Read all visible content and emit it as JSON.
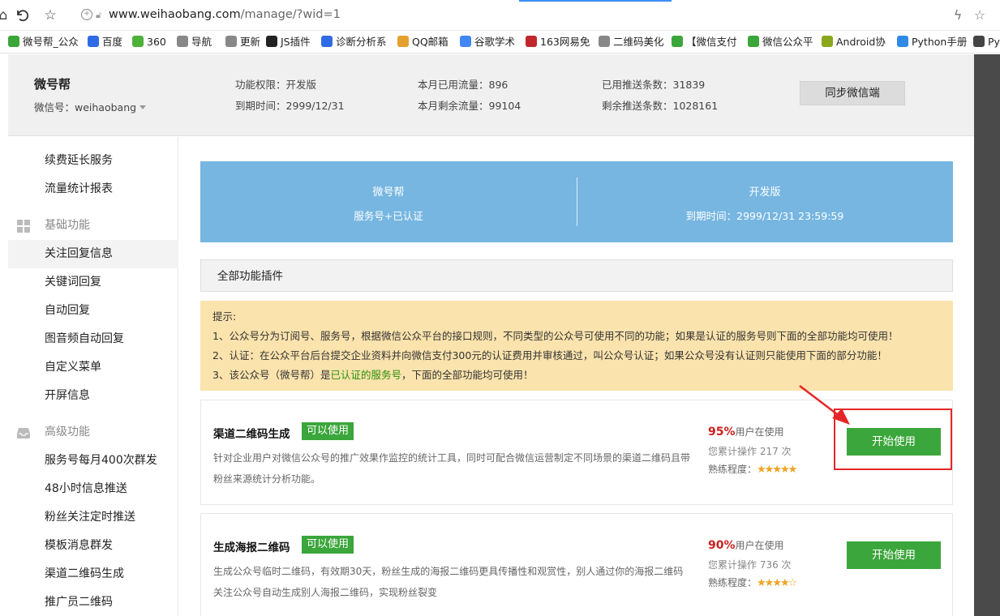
{
  "browser": {
    "url_host": "www.weihaobang.com",
    "url_path": "/manage/?wid=1",
    "bookmarks": [
      {
        "label": "微号帮_公众",
        "icon": "wechat-green",
        "color": "#3ba63b"
      },
      {
        "label": "百度",
        "icon": "baidu-paw",
        "color": "#2f6be5"
      },
      {
        "label": "360",
        "icon": "360-circle",
        "color": "#4db13a"
      },
      {
        "label": "导航",
        "icon": "page-icon",
        "color": "#888888"
      },
      {
        "label": "更新",
        "icon": "page-icon",
        "color": "#888888"
      },
      {
        "label": "JS插件",
        "icon": "js-icon",
        "color": "#222222"
      },
      {
        "label": "诊断分析系",
        "icon": "diagnose-icon",
        "color": "#2f6be5"
      },
      {
        "label": "QQ邮箱",
        "icon": "qq-mail-icon",
        "color": "#e5a12f"
      },
      {
        "label": "谷歌学术",
        "icon": "google-icon",
        "color": "#4285f4"
      },
      {
        "label": "163网易免",
        "icon": "163-icon",
        "color": "#c0282d"
      },
      {
        "label": "二维码美化",
        "icon": "page-icon",
        "color": "#888888"
      },
      {
        "label": "【微信支付",
        "icon": "wechat-green",
        "color": "#3ba63b"
      },
      {
        "label": "微信公众平",
        "icon": "wechat-green",
        "color": "#3ba63b"
      },
      {
        "label": "Android协",
        "icon": "android-icon",
        "color": "#8aa61a"
      },
      {
        "label": "Python手册",
        "icon": "python-icon",
        "color": "#2f8ae5"
      },
      {
        "label": "Py",
        "icon": "book-icon",
        "color": "#444444"
      }
    ]
  },
  "header": {
    "account_name": "微号帮",
    "account_id": "微信号：weihaobang",
    "stats": [
      "功能权限：开发版",
      "到期时间：2999/12/31",
      "本月已用流量：896",
      "本月剩余流量：99104",
      "已用推送条数：31839",
      "剩余推送条数：1028161"
    ],
    "sync_label": "同步微信端"
  },
  "sidebar": {
    "items_top": [
      "续费延长服务",
      "流量统计报表"
    ],
    "group_basic": "基础功能",
    "items_basic": [
      "关注回复信息",
      "关键词回复",
      "自动回复",
      "图音频自动回复",
      "自定义菜单",
      "开屏信息"
    ],
    "group_advanced": "高级功能",
    "items_advanced": [
      "服务号每月400次群发",
      "48小时信息推送",
      "粉丝关注定时推送",
      "模板消息群发",
      "渠道二维码生成",
      "推广员二维码"
    ]
  },
  "banner": {
    "left_title": "微号帮",
    "left_sub": "服务号+已认证",
    "right_title": "开发版",
    "right_sub": "到期时间：2999/12/31 23:59:59"
  },
  "plugins": {
    "heading": "全部功能插件"
  },
  "tips": {
    "title": "提示:",
    "line1": "1、公众号分为订阅号、服务号，根据微信公众平台的接口规则，不同类型的公众号可使用不同的功能；如果是认证的服务号则下面的全部功能均可使用！",
    "line2": "2、认证：在公众平台后台提交企业资料并向微信支付300元的认证费用并审核通过，叫公众号认证；如果公众号没有认证则只能使用下面的部分功能！",
    "line3_pre": "3、该公众号（微号帮）是",
    "line3_highlight": "已认证的服务号",
    "line3_post": "，下面的全部功能均可使用！"
  },
  "cards": [
    {
      "title": "渠道二维码生成",
      "badge": "可以使用",
      "desc": "针对企业用户对微信公众号的推广效果作监控的统计工具，同时可配合微信运营制定不同场景的渠道二维码且带粉丝来源统计分析功能。",
      "percent": "95%",
      "percent_suffix": "用户在使用",
      "ops": "您累计操作 217 次",
      "skill_label": "熟练程度：",
      "stars": "★★★★★",
      "stars_value": 5,
      "button": "开始使用"
    },
    {
      "title": "生成海报二维码",
      "badge": "可以使用",
      "desc": "生成公众号临时二维码，有效期30天，粉丝生成的海报二维码更具传播性和观赏性，别人通过你的海报二维码关注公众号自动生成别人海报二维码，实现粉丝裂变",
      "percent": "90%",
      "percent_suffix": "用户在使用",
      "ops": "您累计操作 736 次",
      "skill_label": "熟练程度：",
      "stars": "★★★★☆",
      "stars_value": 4,
      "button": "开始使用"
    }
  ],
  "colors": {
    "banner_blue": "#77b6e1",
    "action_green": "#3ba63b",
    "tips_bg": "#fbe3ad",
    "highlight_red": "#e52626",
    "percent_red": "#cc1f1f",
    "star_gold": "#f1a324"
  }
}
